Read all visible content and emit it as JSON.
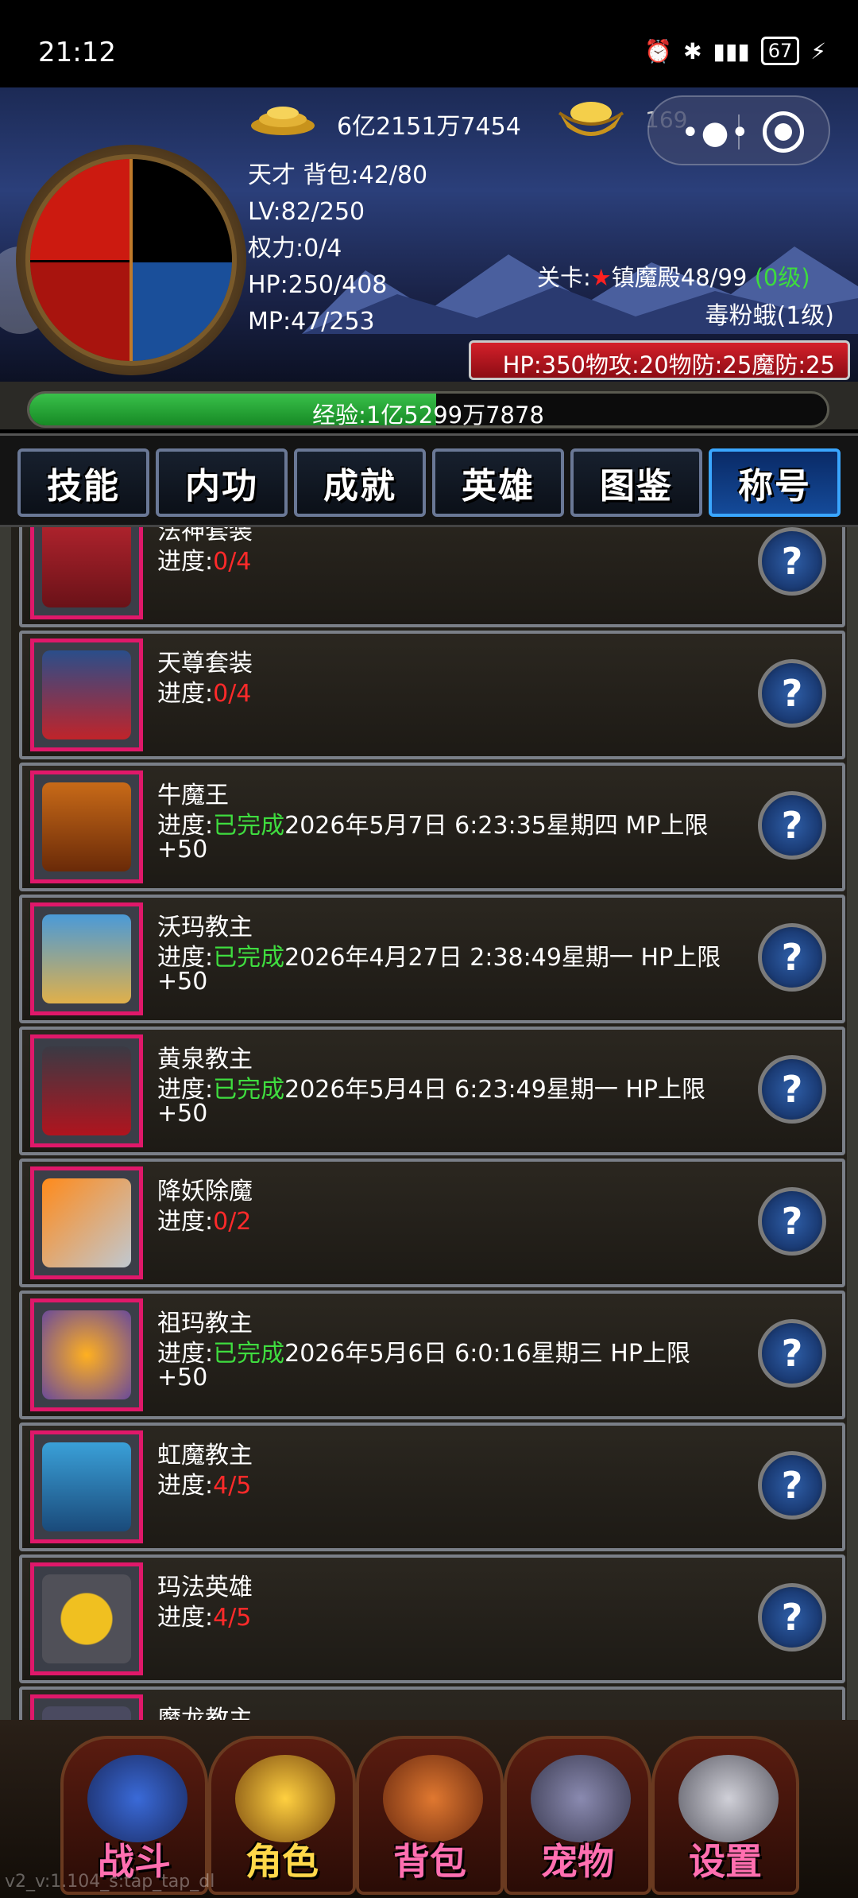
{
  "status_bar": {
    "time": "21:12",
    "icons": [
      "alarm-icon",
      "bluetooth-icon",
      "4g-icon",
      "signal-icon"
    ],
    "battery": "67"
  },
  "player": {
    "gold": "6亿2151万7454",
    "ingot": "169",
    "rank_bag": "天才  背包:42/80",
    "level": "LV:82/250",
    "power": "权力:0/4",
    "hp": "HP:250/408",
    "mp": "MP:47/253",
    "exp_text": "经验:1亿5299万7878",
    "exp_fraction": 0.51
  },
  "stage": {
    "label": "关卡:",
    "star": "★",
    "name": "镇魔殿48/99",
    "level": "(0级)"
  },
  "monster": {
    "name": "毒粉蛾(1级)",
    "stats": "HP:350物攻:20物防:25魔防:25"
  },
  "tabs": [
    {
      "label": "技能"
    },
    {
      "label": "内功"
    },
    {
      "label": "成就"
    },
    {
      "label": "英雄"
    },
    {
      "label": "图鉴"
    },
    {
      "label": "称号"
    }
  ],
  "titles": [
    {
      "name": "法神套装",
      "prog_label": "进度:",
      "status": "0/4",
      "detail": "",
      "bonus": ""
    },
    {
      "name": "天尊套装",
      "prog_label": "进度:",
      "status": "0/4",
      "detail": "",
      "bonus": ""
    },
    {
      "name": "牛魔王",
      "prog_label": "进度:",
      "status": "已完成",
      "detail": "2026年5月7日 6:23:35星期四  MP上限",
      "bonus": "+50"
    },
    {
      "name": "沃玛教主",
      "prog_label": "进度:",
      "status": "已完成",
      "detail": "2026年4月27日 2:38:49星期一  HP上限",
      "bonus": "+50"
    },
    {
      "name": "黄泉教主",
      "prog_label": "进度:",
      "status": "已完成",
      "detail": "2026年5月4日 6:23:49星期一  HP上限",
      "bonus": "+50"
    },
    {
      "name": "降妖除魔",
      "prog_label": "进度:",
      "status": "0/2",
      "detail": "",
      "bonus": ""
    },
    {
      "name": "祖玛教主",
      "prog_label": "进度:",
      "status": "已完成",
      "detail": "2026年5月6日 6:0:16星期三  HP上限",
      "bonus": "+50"
    },
    {
      "name": "虹魔教主",
      "prog_label": "进度:",
      "status": "4/5",
      "detail": "",
      "bonus": ""
    },
    {
      "name": "玛法英雄",
      "prog_label": "进度:",
      "status": "4/5",
      "detail": "",
      "bonus": ""
    },
    {
      "name": "魔龙教主",
      "prog_label": "",
      "status": "",
      "detail": "",
      "bonus": ""
    }
  ],
  "help_label": "?",
  "bottom_nav": [
    {
      "label": "战斗"
    },
    {
      "label": "角色"
    },
    {
      "label": "背包"
    },
    {
      "label": "宠物"
    },
    {
      "label": "设置"
    }
  ],
  "version": "v2_v:1.104_s:tap_tap_dl",
  "colors": {
    "accent_red": "#ff2a2a",
    "accent_green": "#3fdc3f",
    "active_tab": "#144a99",
    "active_nav": "#ffd84a"
  }
}
